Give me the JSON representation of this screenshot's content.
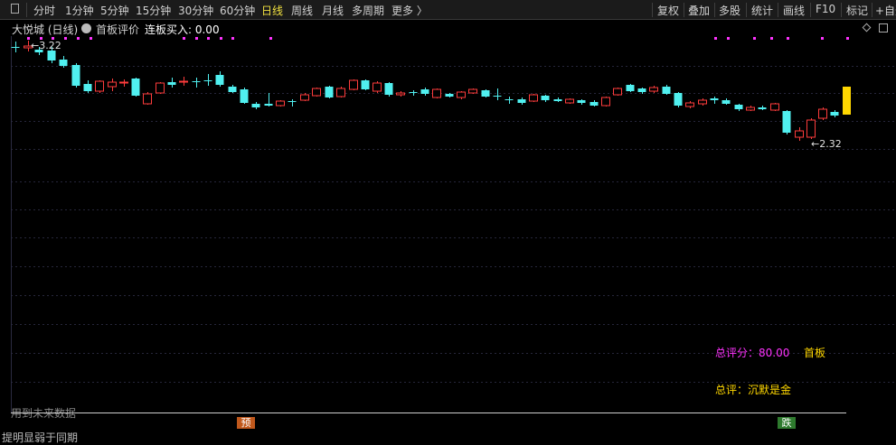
{
  "toolbar": {
    "tabs": [
      "分时",
      "1分钟",
      "5分钟",
      "15分钟",
      "30分钟",
      "60分钟",
      "日线",
      "周线",
      "月线",
      "多周期",
      "更多 〉"
    ],
    "active_tab": "日线",
    "right_buttons": [
      "复权",
      "叠加",
      "多股",
      "统计",
      "画线",
      "F10",
      "标记",
      "+自选"
    ]
  },
  "chart": {
    "title": "大悦城 (日线)",
    "indicator_name": "首板评价",
    "indicator_value": "连板买入: 0.00",
    "high_label": "←3.22",
    "low_label": "←2.32",
    "score_text": "总评分：80.00",
    "board_text": "首板",
    "eval_text": "总评：沉默是金",
    "future_text": "用到未来数据",
    "marker_left": "预",
    "marker_right": "跌",
    "bottom_text": "提明显弱于同期"
  },
  "colors": {
    "up": "#ff3c3c",
    "down": "#50f0f0",
    "magenta": "#ff33ff",
    "yellow": "#ffd700",
    "grid": "#26263a"
  },
  "icons": [
    "chevron-left-icon",
    "circle-info-icon",
    "diamond-icon",
    "box-icon"
  ]
}
